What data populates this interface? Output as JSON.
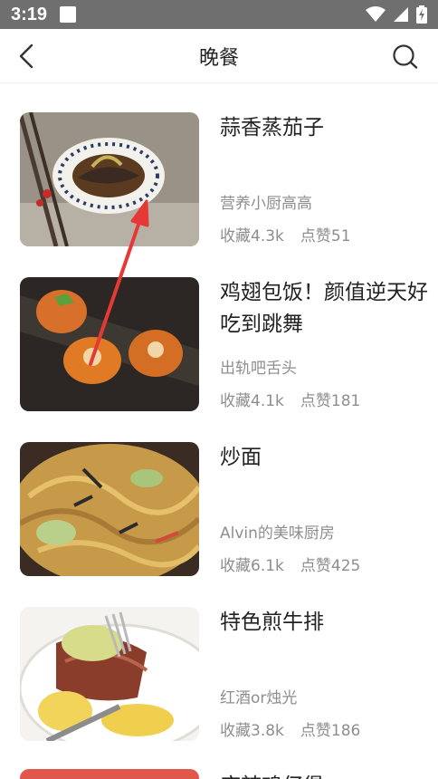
{
  "status_bar": {
    "time": "3:19",
    "icons": [
      "notification-icon",
      "wifi-icon",
      "cell-signal-icon",
      "battery-charging-icon"
    ]
  },
  "header": {
    "title": "晚餐",
    "back_icon": "back-arrow-icon",
    "search_icon": "search-icon"
  },
  "recipes": [
    {
      "name": "蒜香蒸茄子",
      "author": "营养小厨高高",
      "favorites": "收藏4.3k",
      "likes": "点赞51"
    },
    {
      "name": "鸡翅包饭！颜值逆天好吃到跳舞",
      "author": "出轨吧舌头",
      "favorites": "收藏4.1k",
      "likes": "点赞181"
    },
    {
      "name": "炒面",
      "author": "Alvin的美味厨房",
      "favorites": "收藏6.1k",
      "likes": "点赞425"
    },
    {
      "name": "特色煎牛排",
      "author": "红酒or烛光",
      "favorites": "收藏3.8k",
      "likes": "点赞186"
    },
    {
      "name": "麻辣鸡仔煲",
      "author": "",
      "favorites": "",
      "likes": ""
    }
  ],
  "colors": {
    "status_bar": "#6f6f6f",
    "text_primary": "#222222",
    "text_secondary": "#8e8e8e",
    "annotation_arrow": "#e53935"
  }
}
